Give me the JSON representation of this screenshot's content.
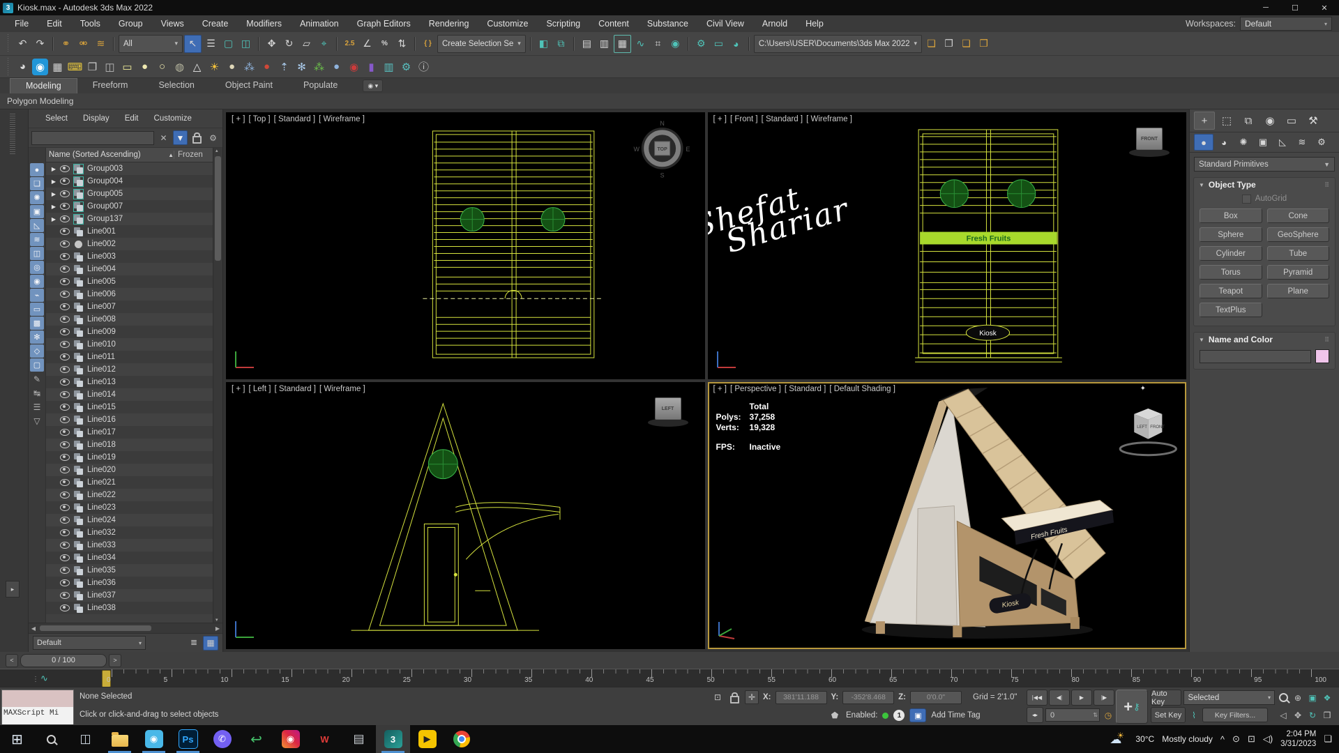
{
  "window": {
    "app_icon": "3",
    "title": "Kiosk.max - Autodesk 3ds Max 2022",
    "minimize": "─",
    "maximize": "☐",
    "close": "✕"
  },
  "menu_bar": {
    "items": [
      "File",
      "Edit",
      "Tools",
      "Group",
      "Views",
      "Create",
      "Modifiers",
      "Animation",
      "Graph Editors",
      "Rendering",
      "Customize",
      "Scripting",
      "Content",
      "Substance",
      "Civil View",
      "Arnold",
      "Help"
    ],
    "workspaces_label": "Workspaces:",
    "workspace_value": "Default",
    "workspace_caret": "▾"
  },
  "toolbar_main": {
    "items": [
      {
        "name": "undo-icon",
        "glyph": "↶"
      },
      {
        "name": "redo-icon",
        "glyph": "↷"
      },
      {
        "cls": "sep"
      },
      {
        "name": "select-and-link-icon",
        "glyph": "⚭",
        "color": "#d9a33c"
      },
      {
        "name": "unlink-selection-icon",
        "glyph": "⚮",
        "color": "#d9a33c"
      },
      {
        "name": "bind-to-space-warp-icon",
        "glyph": "≋",
        "color": "#d9a33c"
      },
      {
        "cls": "sep"
      },
      {
        "name": "selection-filter-dropdown",
        "label": "All",
        "glyph": "▾",
        "cls": "dd"
      },
      {
        "name": "select-object-icon",
        "glyph": "↖",
        "cls": "active"
      },
      {
        "name": "select-by-name-icon",
        "glyph": "☰"
      },
      {
        "name": "rectangular-selection-region-icon",
        "glyph": "▢",
        "color": "#4fc3b8"
      },
      {
        "name": "window-crossing-icon",
        "glyph": "◫",
        "color": "#4fc3b8"
      },
      {
        "cls": "sep"
      },
      {
        "name": "select-and-move-icon",
        "glyph": "✥"
      },
      {
        "name": "select-and-rotate-icon",
        "glyph": "↻"
      },
      {
        "name": "select-and-scale-icon",
        "glyph": "▱"
      },
      {
        "name": "select-and-place-icon",
        "glyph": "⌖",
        "color": "#4fc3b8"
      },
      {
        "cls": "sep"
      },
      {
        "name": "snaps-toggle-icon",
        "glyph": "2.5",
        "cls": "txt",
        "color": "#d9a33c"
      },
      {
        "name": "angle-snap-icon",
        "glyph": "∠"
      },
      {
        "name": "percent-snap-icon",
        "glyph": "%",
        "cls": "txt"
      },
      {
        "name": "spinner-snap-icon",
        "glyph": "⇅"
      },
      {
        "cls": "sep"
      },
      {
        "name": "edit-named-selection-sets-icon",
        "glyph": "{ }",
        "cls": "txt",
        "color": "#d9a33c"
      },
      {
        "name": "named-selection-sets-dropdown",
        "label": "Create Selection Se",
        "glyph": "▾",
        "cls": "dd"
      },
      {
        "cls": "sep"
      },
      {
        "name": "mirror-icon",
        "glyph": "◧",
        "color": "#4fc3b8"
      },
      {
        "name": "align-icon",
        "glyph": "⧉",
        "color": "#4fc3b8"
      },
      {
        "cls": "sep"
      },
      {
        "name": "toggle-scene-explorer-icon",
        "glyph": "▤"
      },
      {
        "name": "toggle-layer-explorer-icon",
        "glyph": "▥"
      },
      {
        "name": "toggle-ribbon-icon",
        "glyph": "▦",
        "cls": "outlined"
      },
      {
        "name": "curve-editor-icon",
        "glyph": "∿",
        "color": "#4fc3b8"
      },
      {
        "name": "schematic-view-icon",
        "glyph": "⌗"
      },
      {
        "name": "material-editor-icon",
        "glyph": "◉",
        "color": "#4fc3b8"
      },
      {
        "cls": "sep"
      },
      {
        "name": "render-setup-icon",
        "glyph": "⚙",
        "color": "#4fc3b8"
      },
      {
        "name": "rendered-frame-window-icon",
        "glyph": "▭",
        "color": "#4fc3b8"
      },
      {
        "name": "render-production-icon",
        "glyph": "◕",
        "color": "#4fc3b8"
      },
      {
        "cls": "sep"
      },
      {
        "name": "project-folder-dropdown",
        "label": "C:\\Users\\USER\\Documents\\3ds Max 2022",
        "glyph": "▾",
        "cls": "dd wide"
      },
      {
        "name": "new-project-folder-icon",
        "glyph": "❏",
        "color": "#d9a33c"
      },
      {
        "name": "set-project-folder-icon",
        "glyph": "❐",
        "color": "#cfcfcf"
      },
      {
        "name": "open-project-folder-icon",
        "glyph": "❏",
        "color": "#d9a33c"
      },
      {
        "name": "project-folder-options-icon",
        "glyph": "❐",
        "color": "#d9a33c"
      }
    ]
  },
  "toolbar_custom": {
    "items": [
      {
        "name": "teapot-icon",
        "glyph": "◕",
        "color": "#d8d8d8"
      },
      {
        "name": "browser-app-icon",
        "glyph": "◉",
        "color": "#ffffff",
        "bg": "#2196d8"
      },
      {
        "name": "monitor-icon",
        "glyph": "▦",
        "color": "#cfcfcf"
      },
      {
        "name": "keyboard-shortcut-icon",
        "glyph": "⌨",
        "color": "#e8c83d"
      },
      {
        "name": "state-sets-icon",
        "glyph": "❐",
        "color": "#c8c8c8"
      },
      {
        "name": "camera-icon",
        "glyph": "◫",
        "color": "#b8b8b8"
      },
      {
        "name": "rect-light-icon",
        "glyph": "▭",
        "color": "#f0ec9a"
      },
      {
        "name": "oval-light-icon",
        "glyph": "●",
        "color": "#efe9b0"
      },
      {
        "name": "sphere-light-icon",
        "glyph": "○",
        "color": "#efe9b0"
      },
      {
        "name": "mesh-sphere-icon",
        "glyph": "◍",
        "color": "#b8b8a0"
      },
      {
        "name": "cone-icon",
        "glyph": "△",
        "color": "#e8e8e8"
      },
      {
        "name": "sun-light-icon",
        "glyph": "☀",
        "color": "#f5c33b"
      },
      {
        "name": "egg-icon",
        "glyph": "●",
        "color": "#ded6b8"
      },
      {
        "name": "particles-icon",
        "glyph": "⁂",
        "color": "#8fb3dd"
      },
      {
        "name": "balloon-icon",
        "glyph": "●",
        "color": "#d04838"
      },
      {
        "name": "arrows-up-icon",
        "glyph": "⇡",
        "color": "#a8c8e8"
      },
      {
        "name": "snowflake-icon",
        "glyph": "✻",
        "color": "#a8c8e8"
      },
      {
        "name": "grass-icon",
        "glyph": "⁂",
        "color": "#6cc24a"
      },
      {
        "name": "blue-sphere-icon",
        "glyph": "●",
        "color": "#8fb3dd"
      },
      {
        "name": "red-balls-icon",
        "glyph": "◉",
        "color": "#cc3b3b"
      },
      {
        "name": "purple-block-icon",
        "glyph": "▮",
        "color": "#8659c9"
      },
      {
        "name": "display-settings-icon",
        "glyph": "▥",
        "color": "#58c0c0"
      },
      {
        "name": "camera-settings-icon",
        "glyph": "⚙",
        "color": "#58c0c0"
      },
      {
        "name": "info-icon",
        "glyph": "ⓘ",
        "color": "#c8c8c8"
      }
    ]
  },
  "ribbon": {
    "tabs": [
      {
        "label": "Modeling",
        "cls": "active",
        "name": "tab-modeling"
      },
      {
        "label": "Freeform",
        "name": "tab-freeform"
      },
      {
        "label": "Selection",
        "name": "tab-selection"
      },
      {
        "label": "Object Paint",
        "name": "tab-object-paint"
      },
      {
        "label": "Populate",
        "name": "tab-populate"
      }
    ],
    "more_button": "◉ ▾",
    "panel_label": "Polygon Modeling"
  },
  "scene_explorer": {
    "menu": [
      "Select",
      "Display",
      "Edit",
      "Customize"
    ],
    "clear_glyph": "✕",
    "filter_glyph": "▼",
    "settings_glyph": "⚙",
    "header": "Name (Sorted Ascending)",
    "sort_arrow": "▲",
    "frozen_column": "Frozen",
    "strip": [
      {
        "name": "display-geometry-filter-icon",
        "glyph": "●"
      },
      {
        "name": "display-shapes-filter-icon",
        "glyph": "❏"
      },
      {
        "name": "display-lights-filter-icon",
        "glyph": "✺"
      },
      {
        "name": "display-cameras-filter-icon",
        "glyph": "▣"
      },
      {
        "name": "display-helpers-filter-icon",
        "glyph": "◺"
      },
      {
        "name": "display-spacewarps-filter-icon",
        "glyph": "≋"
      },
      {
        "name": "display-groups-filter-icon",
        "glyph": "◫"
      },
      {
        "name": "display-xrefs-filter-icon",
        "glyph": "◎"
      },
      {
        "name": "display-materials-filter-icon",
        "glyph": "◉"
      },
      {
        "name": "display-bones-filter-icon",
        "glyph": "⌁"
      },
      {
        "name": "display-containers-filter-icon",
        "glyph": "▭"
      },
      {
        "name": "display-objects-filter-icon",
        "glyph": "▩"
      },
      {
        "name": "display-frozen-filter-icon",
        "glyph": "✻"
      },
      {
        "name": "display-hidden-filter-icon",
        "glyph": "◇"
      },
      {
        "name": "display-sets-filter-icon",
        "glyph": "▢"
      },
      {
        "name": "pin-explorer-icon",
        "glyph": "✎",
        "cls": "gray"
      },
      {
        "name": "sync-selection-icon",
        "glyph": "↹",
        "cls": "gray"
      },
      {
        "name": "explorer-menu-icon",
        "glyph": "☰",
        "cls": "gray"
      },
      {
        "name": "explorer-collapse-icon",
        "glyph": "▽",
        "cls": "gray"
      }
    ],
    "items": [
      {
        "name": "Group003",
        "cls": "group"
      },
      {
        "name": "Group004",
        "cls": "group"
      },
      {
        "name": "Group005",
        "cls": "group"
      },
      {
        "name": "Group007",
        "cls": "group"
      },
      {
        "name": "Group137",
        "cls": "group"
      },
      {
        "name": "Line001",
        "cls": "shape"
      },
      {
        "name": "Line002",
        "cls": "circle"
      },
      {
        "name": "Line003",
        "cls": "shape"
      },
      {
        "name": "Line004",
        "cls": "shape"
      },
      {
        "name": "Line005",
        "cls": "shape"
      },
      {
        "name": "Line006",
        "cls": "shape"
      },
      {
        "name": "Line007",
        "cls": "shape"
      },
      {
        "name": "Line008",
        "cls": "shape"
      },
      {
        "name": "Line009",
        "cls": "shape"
      },
      {
        "name": "Line010",
        "cls": "shape"
      },
      {
        "name": "Line011",
        "cls": "shape"
      },
      {
        "name": "Line012",
        "cls": "shape"
      },
      {
        "name": "Line013",
        "cls": "shape"
      },
      {
        "name": "Line014",
        "cls": "shape"
      },
      {
        "name": "Line015",
        "cls": "shape"
      },
      {
        "name": "Line016",
        "cls": "shape"
      },
      {
        "name": "Line017",
        "cls": "shape"
      },
      {
        "name": "Line018",
        "cls": "shape"
      },
      {
        "name": "Line019",
        "cls": "shape"
      },
      {
        "name": "Line020",
        "cls": "shape"
      },
      {
        "name": "Line021",
        "cls": "shape"
      },
      {
        "name": "Line022",
        "cls": "shape"
      },
      {
        "name": "Line023",
        "cls": "shape"
      },
      {
        "name": "Line024",
        "cls": "shape"
      },
      {
        "name": "Line032",
        "cls": "shape"
      },
      {
        "name": "Line033",
        "cls": "shape"
      },
      {
        "name": "Line034",
        "cls": "shape"
      },
      {
        "name": "Line035",
        "cls": "shape"
      },
      {
        "name": "Line036",
        "cls": "shape"
      },
      {
        "name": "Line037",
        "cls": "shape"
      },
      {
        "name": "Line038",
        "cls": "shape"
      }
    ],
    "layer_dropdown": "Default",
    "layer_caret": "▾",
    "layer_buttons": [
      {
        "name": "layer-list-icon",
        "glyph": "≣"
      },
      {
        "name": "layer-grid-icon",
        "glyph": "▦",
        "cls": "sel"
      }
    ]
  },
  "viewports": {
    "top": {
      "label": [
        "[ + ]",
        "[ Top ]",
        "[ Standard ]",
        "[ Wireframe ]"
      ],
      "compass": {
        "n": "N",
        "e": "E",
        "s": "S",
        "w": "W",
        "center": "TOP"
      }
    },
    "front": {
      "label": [
        "[ + ]",
        "[ Front ]",
        "[ Standard ]",
        "[ Wireframe ]"
      ],
      "banner": "Fresh Fruits",
      "sign": "Kiosk",
      "signature_line1": "Shefat",
      "signature_line2": "Shariar",
      "gizmo": "FRONT"
    },
    "left": {
      "label": [
        "[ + ]",
        "[ Left ]",
        "[ Standard ]",
        "[ Wireframe ]"
      ],
      "gizmo": "LEFT"
    },
    "perspective": {
      "label": [
        "[ + ]",
        "[ Perspective ]",
        "[ Standard ]",
        "[ Default Shading ]"
      ],
      "stats": {
        "total_label": "Total",
        "polys_label": "Polys:",
        "polys": "37,258",
        "verts_label": "Verts:",
        "verts": "19,328",
        "fps_label": "FPS:",
        "fps": "Inactive"
      },
      "counter_sign": "Fresh Fruits",
      "front_sign": "Kiosk",
      "viewcube_left": "LEFT",
      "viewcube_front": "FRONT",
      "corner_icon": "✦"
    }
  },
  "command_panel": {
    "tabs": [
      {
        "name": "create-tab-icon",
        "glyph": "+",
        "cls": "active"
      },
      {
        "name": "modify-tab-icon",
        "glyph": "⬚"
      },
      {
        "name": "hierarchy-tab-icon",
        "glyph": "⧉"
      },
      {
        "name": "motion-tab-icon",
        "glyph": "◉"
      },
      {
        "name": "display-tab-icon",
        "glyph": "▭"
      },
      {
        "name": "utilities-tab-icon",
        "glyph": "⚒"
      }
    ],
    "categories": [
      {
        "name": "geometry-category-icon",
        "glyph": "●",
        "cls": "active"
      },
      {
        "name": "shapes-category-icon",
        "glyph": "◕"
      },
      {
        "name": "lights-category-icon",
        "glyph": "✺"
      },
      {
        "name": "cameras-category-icon",
        "glyph": "▣"
      },
      {
        "name": "helpers-category-icon",
        "glyph": "◺"
      },
      {
        "name": "space-warps-category-icon",
        "glyph": "≋"
      },
      {
        "name": "systems-category-icon",
        "glyph": "⚙"
      }
    ],
    "category_dropdown": "Standard Primitives",
    "dropdown_caret": "▼",
    "rollout_arrow": "▼",
    "grip": "⠿",
    "object_type_title": "Object Type",
    "autogrid_label": "AutoGrid",
    "buttons": [
      "Box",
      "Cone",
      "Sphere",
      "GeoSphere",
      "Cylinder",
      "Tube",
      "Torus",
      "Pyramid",
      "Teapot",
      "Plane",
      "TextPlus"
    ],
    "name_color_title": "Name and Color",
    "swatch_color": "#f0c4ea"
  },
  "timeline": {
    "prev": "<",
    "frame": "0 / 100",
    "next": ">",
    "labels": [
      "0",
      "5",
      "10",
      "15",
      "20",
      "25",
      "30",
      "35",
      "40",
      "45",
      "50",
      "55",
      "60",
      "65",
      "70",
      "75",
      "80",
      "85",
      "90",
      "95",
      "100"
    ]
  },
  "status_bar": {
    "maxscript_label": "MAXScript Mi",
    "selection_status": "None Selected",
    "prompt": "Click or click-and-drag to select objects",
    "isolate_glyph": "⊡",
    "offset_glyph": "✛",
    "x_label": "X:",
    "x_value": "381'11.188",
    "y_label": "Y:",
    "y_value": "-352'8.468",
    "z_label": "Z:",
    "z_value": "0'0.0\"",
    "grid_label": "Grid = 2'1.0\"",
    "shield_glyph": "⬟",
    "enabled_label": "Enabled:",
    "anim_layer_badge": "1",
    "cube_glyph": "▣",
    "add_time_tag": "Add Time Tag",
    "playback": [
      {
        "name": "go-to-start-button",
        "glyph": "|◀◀"
      },
      {
        "name": "previous-frame-button",
        "glyph": "◀|"
      },
      {
        "name": "play-button",
        "glyph": "▶"
      },
      {
        "name": "next-frame-button",
        "glyph": "|▶"
      },
      {
        "name": "go-to-end-button",
        "glyph": "▶▶|"
      }
    ],
    "frame_spinner_glyph": "◂▸",
    "frame_field": "0",
    "key_clock_glyph": "◷",
    "set_keys_plus": "+",
    "set_keys_key": "⚷",
    "auto_key": "Auto Key",
    "set_key": "Set Key",
    "key_mode_dropdown": "Selected",
    "key_mode_caret": "▾",
    "key_steps_glyph": "⌇",
    "key_filters": "Key Filters...",
    "nav_row1": [
      {
        "name": "zoom-icon",
        "cls": "i-search"
      },
      {
        "name": "zoom-all-icon",
        "glyph": "⊕"
      },
      {
        "name": "zoom-extents-icon",
        "glyph": "▣",
        "color": "#4fc3b8"
      },
      {
        "name": "zoom-extents-all-icon",
        "glyph": "❖",
        "color": "#4fc3b8"
      }
    ],
    "nav_row2": [
      {
        "name": "field-of-view-icon",
        "glyph": "◁"
      },
      {
        "name": "pan-icon",
        "glyph": "✥"
      },
      {
        "name": "orbit-icon",
        "glyph": "↻",
        "color": "#4fc3b8"
      },
      {
        "name": "maximize-viewport-icon",
        "glyph": "❒"
      }
    ]
  },
  "taskbar": {
    "apps": [
      {
        "name": "start-button",
        "glyph": "⊞",
        "color": "#dfe8f2",
        "gcls": "lg"
      },
      {
        "name": "search-button",
        "cls": "srch"
      },
      {
        "name": "task-view-button",
        "glyph": "◫",
        "color": "#cfd8e2"
      },
      {
        "name": "file-explorer-button",
        "cls": "open folder"
      },
      {
        "name": "movavi-button",
        "cls": "open",
        "bg": "#49b8e8",
        "glyph": "◉"
      },
      {
        "name": "photoshop-button",
        "cls": "open ps",
        "label": "Ps"
      },
      {
        "name": "viber-button",
        "cls": "round",
        "bg": "#7360f2",
        "glyph": "✆"
      },
      {
        "name": "sharex-button",
        "glyph": "↩",
        "color": "#45c06a",
        "gcls": "lg"
      },
      {
        "name": "instagram-button",
        "cls": "insta",
        "glyph": "◉"
      },
      {
        "name": "wps-office-button",
        "cls": "wps",
        "label": "W"
      },
      {
        "name": "scanner-button",
        "glyph": "▤",
        "color": "#c8cdd2"
      },
      {
        "name": "3ds-max-button",
        "cls": "open activeapp max",
        "label": "3"
      },
      {
        "name": "player-button",
        "bg": "#f5c400",
        "glyph": "▶",
        "color": "#222222"
      },
      {
        "name": "chrome-button",
        "cls": "chrome"
      }
    ],
    "tray": {
      "temp": "30°C",
      "condition": "Mostly cloudy",
      "expand": "^",
      "meet_glyph": "⊙",
      "network_glyph": "⊡",
      "volume_glyph": "◁)",
      "clock_time": "2:04 PM",
      "clock_date": "3/31/2023",
      "notification_glyph": "❏"
    }
  }
}
